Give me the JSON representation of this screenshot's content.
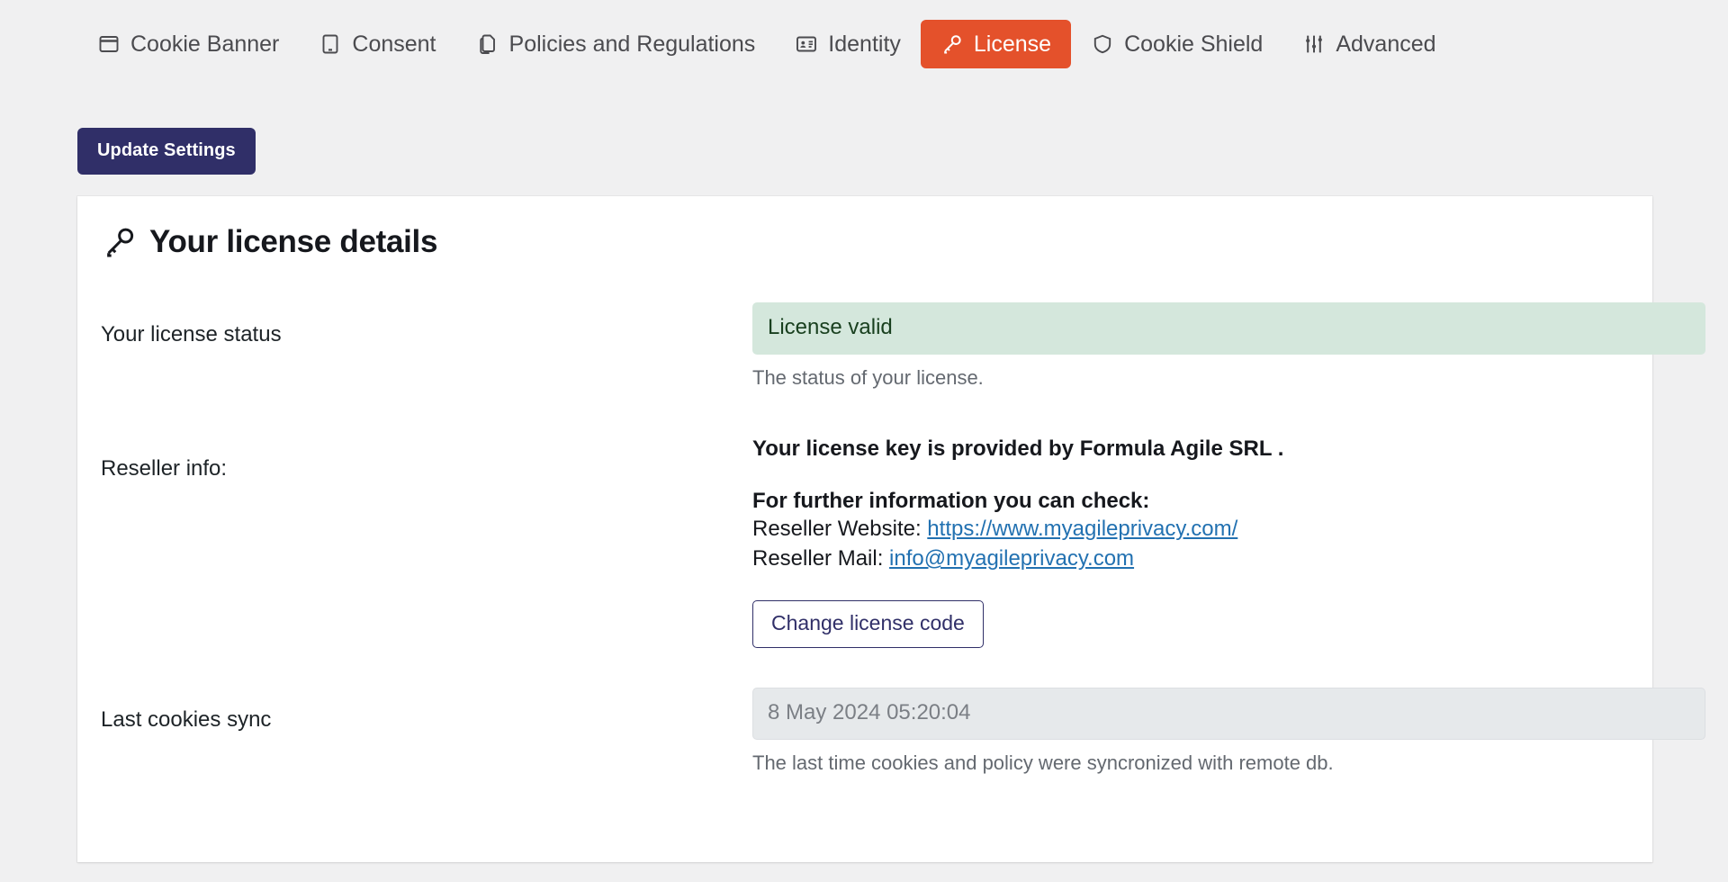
{
  "tabs": [
    {
      "label": "Cookie Banner",
      "icon": "window-icon",
      "active": false
    },
    {
      "label": "Consent",
      "icon": "tablet-icon",
      "active": false
    },
    {
      "label": "Policies and Regulations",
      "icon": "documents-icon",
      "active": false
    },
    {
      "label": "Identity",
      "icon": "id-card-icon",
      "active": false
    },
    {
      "label": "License",
      "icon": "key-icon",
      "active": true
    },
    {
      "label": "Cookie Shield",
      "icon": "shield-icon",
      "active": false
    },
    {
      "label": "Advanced",
      "icon": "sliders-icon",
      "active": false
    }
  ],
  "toolbar": {
    "update_settings_label": "Update Settings"
  },
  "card": {
    "title": "Your license details",
    "title_icon": "key-icon"
  },
  "license_status": {
    "label": "Your license status",
    "value": "License valid",
    "help": "The status of your license."
  },
  "reseller": {
    "label": "Reseller info:",
    "provided_by": "Your license key is provided by Formula Agile SRL .",
    "further_info_heading": "For further information you can check:",
    "website_label": "Reseller Website: ",
    "website_url": "https://www.myagileprivacy.com/",
    "mail_label": "Reseller Mail: ",
    "mail_address": "info@myagileprivacy.com",
    "change_button_label": "Change license code"
  },
  "last_sync": {
    "label": "Last cookies sync",
    "value": "8 May 2024 05:20:04",
    "help": "The last time cookies and policy were syncronized with remote db."
  },
  "colors": {
    "accent_orange": "#e4512b",
    "navy": "#302f68",
    "valid_bg": "#d4e7dc",
    "valid_text": "#19401f",
    "link": "#2271b1",
    "page_bg": "#f0f0f1"
  }
}
